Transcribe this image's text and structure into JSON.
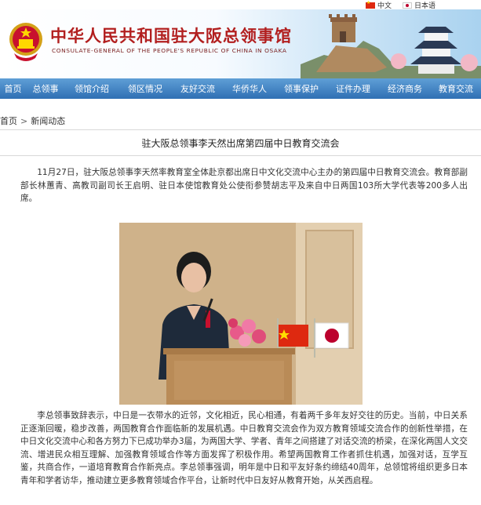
{
  "lang_switch": {
    "zh": "中文",
    "ja": "日本语"
  },
  "header": {
    "title_cn": "中华人民共和国驻大阪总领事馆",
    "title_en": "CONSULATE-GENERAL OF THE PEOPLE'S REPUBLIC OF CHINA IN OSAKA"
  },
  "nav": [
    "首页",
    "总领事",
    "领馆介绍",
    "领区情况",
    "友好交流",
    "华侨华人",
    "领事保护",
    "证件办理",
    "经济商务",
    "教育交流"
  ],
  "breadcrumb": {
    "home": "首页",
    "sep": ">",
    "current": "新闻动态"
  },
  "article": {
    "title": "驻大阪总领事李天然出席第四届中日教育交流会",
    "para1": "11月27日，驻大阪总领事李天然率教育室全体赴京都出席日中文化交流中心主办的第四届中日教育交流会。教育部副部长林蕙青、高教司副司长王启明、驻日本使馆教育处公使衔参赞胡志平及来自中日两国103所大学代表等200多人出席。",
    "para2": "李总领事致辞表示，中日是一衣带水的近邻，文化相近，民心相通，有着两千多年友好交往的历史。当前，中日关系正逐渐回暖，稳步改善，两国教育合作面临新的发展机遇。中日教育交流会作为双方教育领域交流合作的创新性举措，在中日文化交流中心和各方努力下已成功举办3届，为两国大学、学者、青年之间搭建了对话交流的桥梁，在深化两国人文交流、增进民众相互理解、加强教育领域合作等方面发挥了积极作用。希望两国教育工作者抓住机遇，加强对话，互学互鉴，共商合作，一道培育教育合作新亮点。李总领事强调，明年是中日和平友好条约缔结40周年，总领馆将组织更多日本青年和学者访华，推动建立更多教育领域合作平台，让新时代中日友好从教育开始，从关西启程。"
  }
}
